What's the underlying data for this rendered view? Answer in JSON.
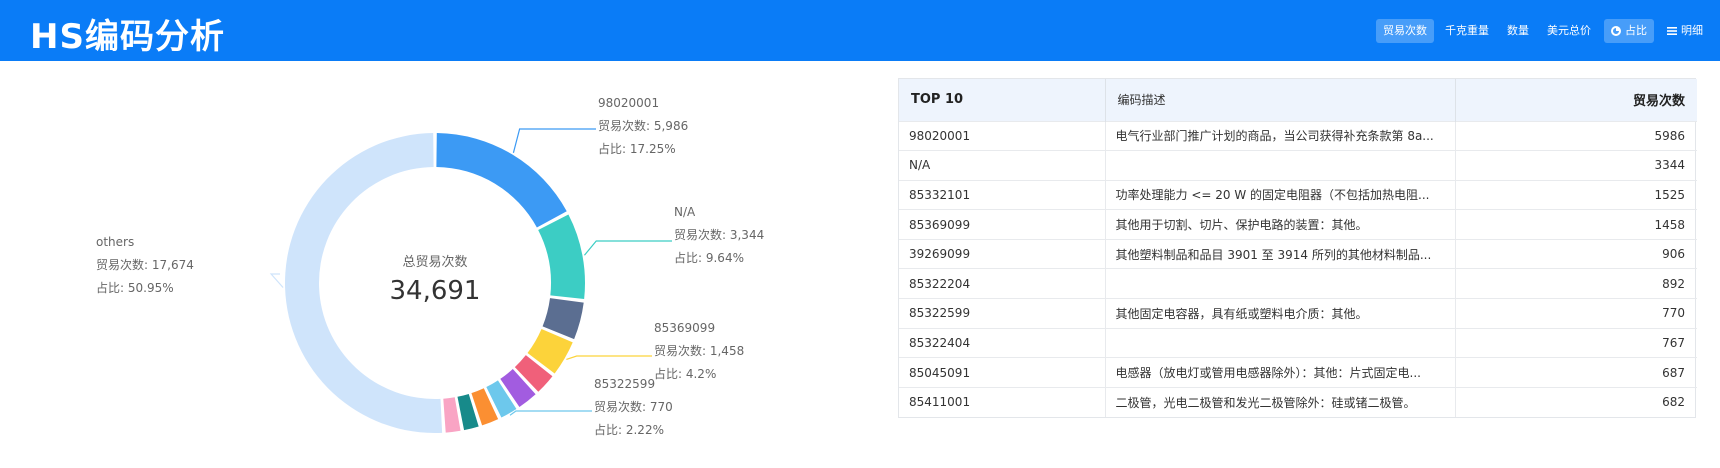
{
  "header": {
    "title": "HS编码分析",
    "metric_tabs": [
      {
        "label": "贸易次数",
        "active": true
      },
      {
        "label": "千克重量",
        "active": false
      },
      {
        "label": "数量",
        "active": false
      },
      {
        "label": "美元总价",
        "active": false
      }
    ],
    "view_buttons": [
      {
        "label": "占比",
        "icon": "pie-icon",
        "active": true
      },
      {
        "label": "明细",
        "icon": "list-icon",
        "active": false
      }
    ]
  },
  "chart_data": {
    "type": "pie",
    "center_label": "总贸易次数",
    "center_value": "34,691",
    "total": 34691,
    "slices": [
      {
        "name": "98020001",
        "value": 5986,
        "percent": 17.25,
        "color": "#3c9af4"
      },
      {
        "name": "N/A",
        "value": 3344,
        "percent": 9.64,
        "color": "#3ccdc4"
      },
      {
        "name": "85332101",
        "value": 1525,
        "percent": 4.4,
        "color": "#5b6e91"
      },
      {
        "name": "85369099",
        "value": 1458,
        "percent": 4.2,
        "color": "#fcd33a"
      },
      {
        "name": "39269099",
        "value": 906,
        "percent": 2.61,
        "color": "#f0607a"
      },
      {
        "name": "85322204",
        "value": 892,
        "percent": 2.57,
        "color": "#a25ce0"
      },
      {
        "name": "85322599",
        "value": 770,
        "percent": 2.22,
        "color": "#6dc8ec"
      },
      {
        "name": "85322404",
        "value": 767,
        "percent": 2.21,
        "color": "#fb8f32"
      },
      {
        "name": "85045091",
        "value": 687,
        "percent": 1.98,
        "color": "#178a8a"
      },
      {
        "name": "85411001",
        "value": 682,
        "percent": 1.97,
        "color": "#f9a4c4"
      },
      {
        "name": "others",
        "value": 17674,
        "percent": 50.95,
        "color": "#cfe4fb"
      }
    ],
    "labels": [
      {
        "slice": 0,
        "name": "98020001",
        "value_text": "贸易次数: 5,986",
        "percent_text": "占比: 17.25%"
      },
      {
        "slice": 1,
        "name": "N/A",
        "value_text": "贸易次数: 3,344",
        "percent_text": "占比: 9.64%"
      },
      {
        "slice": 3,
        "name": "85369099",
        "value_text": "贸易次数: 1,458",
        "percent_text": "占比: 4.2%"
      },
      {
        "slice": 6,
        "name": "85322599",
        "value_text": "贸易次数: 770",
        "percent_text": "占比: 2.22%"
      },
      {
        "slice": 10,
        "name": "others",
        "value_text": "贸易次数: 17,674",
        "percent_text": "占比: 50.95%"
      }
    ]
  },
  "table": {
    "headers": [
      "TOP 10",
      "编码描述",
      "贸易次数"
    ],
    "rows": [
      [
        "98020001",
        "电气行业部门推广计划的商品，当公司获得补充条款第 8a...",
        "5986"
      ],
      [
        "N/A",
        "",
        "3344"
      ],
      [
        "85332101",
        "功率处理能力 <= 20 W 的固定电阻器（不包括加热电阻...",
        "1525"
      ],
      [
        "85369099",
        "其他用于切割、切片、保护电路的装置：其他。",
        "1458"
      ],
      [
        "39269099",
        "其他塑料制品和品目 3901 至 3914 所列的其他材料制品...",
        "906"
      ],
      [
        "85322204",
        "",
        "892"
      ],
      [
        "85322599",
        "其他固定电容器，具有纸或塑料电介质：其他。",
        "770"
      ],
      [
        "85322404",
        "",
        "767"
      ],
      [
        "85045091",
        "电感器（放电灯或管用电感器除外）：其他：片式固定电...",
        "687"
      ],
      [
        "85411001",
        "二极管，光电二极管和发光二极管除外：硅或锗二极管。",
        "682"
      ]
    ]
  }
}
